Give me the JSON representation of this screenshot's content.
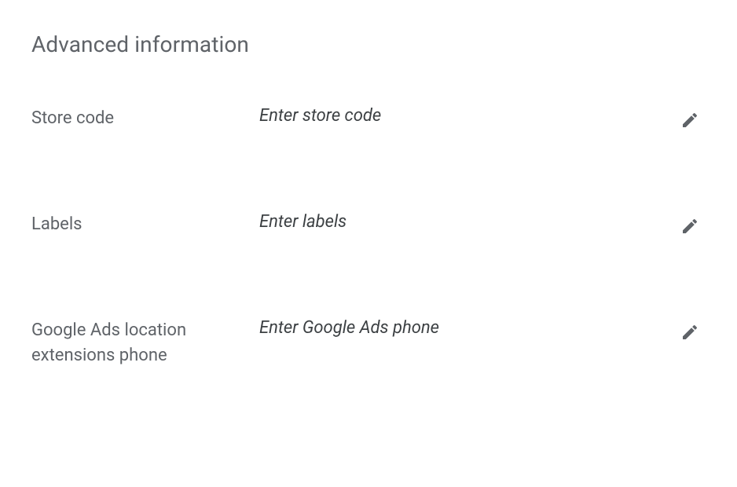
{
  "section": {
    "title": "Advanced information"
  },
  "fields": {
    "storeCode": {
      "label": "Store code",
      "placeholder": "Enter store code"
    },
    "labels": {
      "label": "Labels",
      "placeholder": "Enter labels"
    },
    "googleAdsPhone": {
      "label": "Google Ads location extensions phone",
      "placeholder": "Enter Google Ads phone"
    }
  }
}
